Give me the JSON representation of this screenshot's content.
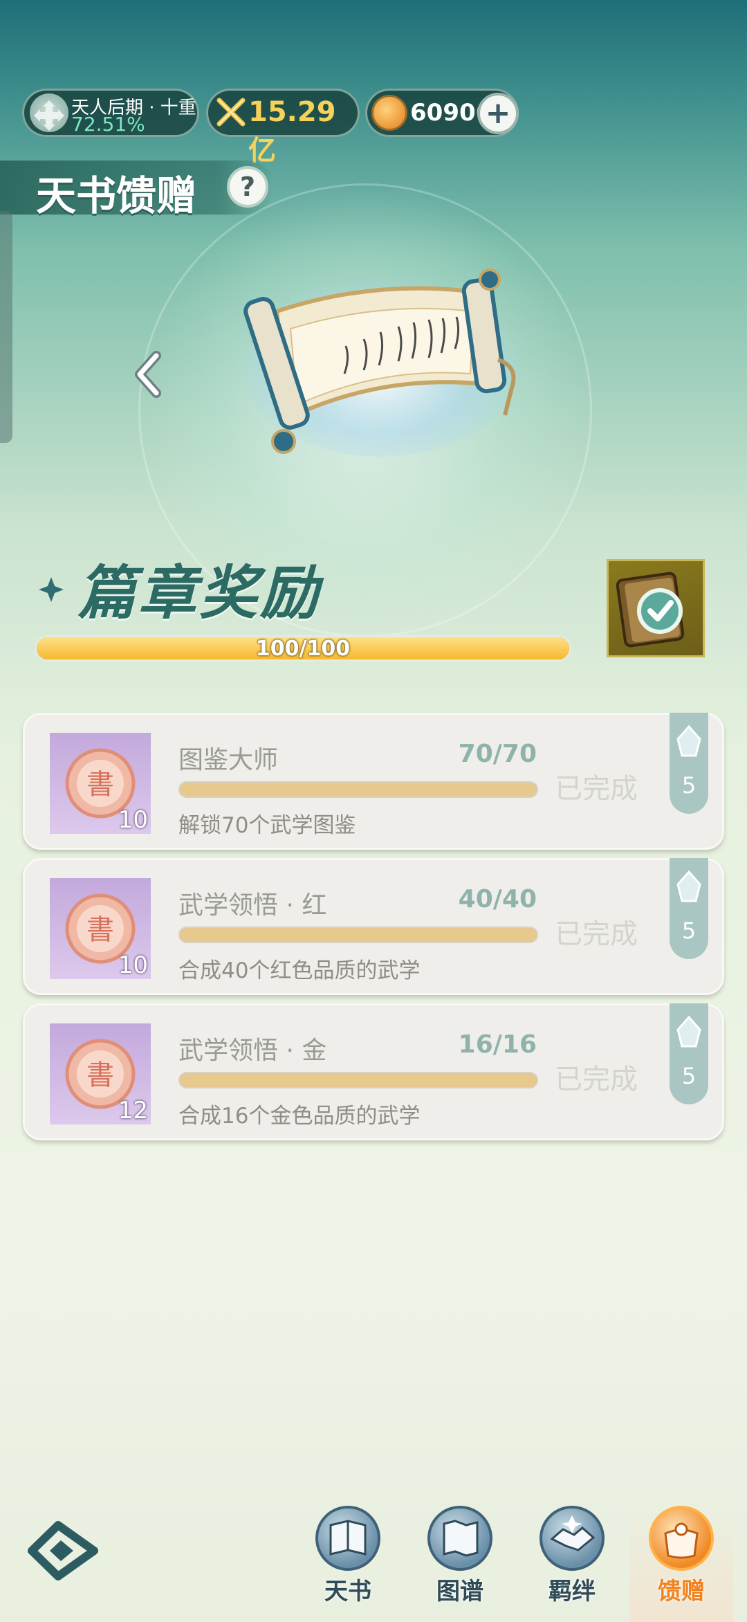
{
  "top_bar": {
    "realm_label": "天人后期 · 十重",
    "realm_percent": "72.51%",
    "power": "15.29亿",
    "currency": "60906"
  },
  "page": {
    "title": "天书馈赠"
  },
  "chapter": {
    "heading": "篇章奖励",
    "progress_text": "100/100",
    "progress_fraction": 1.0
  },
  "tasks": [
    {
      "name": "图鉴大师",
      "ratio": "70/70",
      "desc": "解锁70个武学图鉴",
      "reward_count": "10",
      "status": "已完成",
      "tag_count": "5"
    },
    {
      "name": "武学领悟 · 红",
      "ratio": "40/40",
      "desc": "合成40个红色品质的武学",
      "reward_count": "10",
      "status": "已完成",
      "tag_count": "5"
    },
    {
      "name": "武学领悟 · 金",
      "ratio": "16/16",
      "desc": "合成16个金色品质的武学",
      "reward_count": "12",
      "status": "已完成",
      "tag_count": "5"
    }
  ],
  "nav": [
    {
      "label": "天书",
      "icon": "book-icon"
    },
    {
      "label": "图谱",
      "icon": "map-scroll-icon"
    },
    {
      "label": "羁绊",
      "icon": "handshake-icon"
    },
    {
      "label": "馈赠",
      "icon": "gift-bag-icon",
      "active": true
    }
  ],
  "colors": {
    "accent_orange": "#f3821e",
    "progress_gold": "#f6b92c",
    "heading_teal": "#2c6b64"
  }
}
